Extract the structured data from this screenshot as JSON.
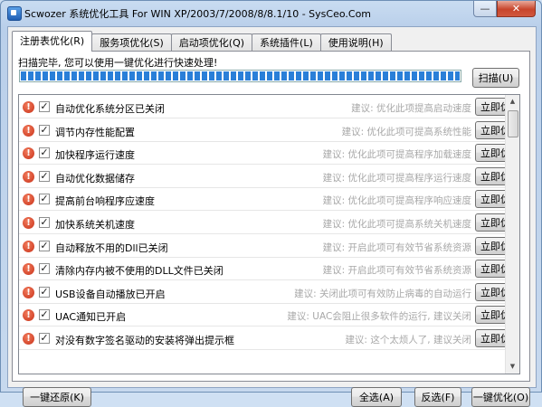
{
  "window": {
    "title": "Scwozer 系统优化工具 For WIN XP/2003/7/2008/8/8.1/10 - SysCeo.Com",
    "minimize_label": "—",
    "close_label": "✕"
  },
  "tabs": [
    {
      "label": "注册表优化(R)",
      "active": true
    },
    {
      "label": "服务项优化(S)",
      "active": false
    },
    {
      "label": "启动项优化(Q)",
      "active": false
    },
    {
      "label": "系统插件(L)",
      "active": false
    },
    {
      "label": "使用说明(H)",
      "active": false
    }
  ],
  "status_text": "扫描完毕, 您可以使用一键优化进行快速处理!",
  "progress": 1.0,
  "scan_button": "扫描(U)",
  "items": [
    {
      "label": "自动优化系统分区已关闭",
      "advice": "建议: 优化此项提高启动速度",
      "checked": true
    },
    {
      "label": "调节内存性能配置",
      "advice": "建议: 优化此项可提高系统性能",
      "checked": true
    },
    {
      "label": "加快程序运行速度",
      "advice": "建议: 优化此项可提高程序加载速度",
      "checked": true
    },
    {
      "label": "自动优化数据储存",
      "advice": "建议: 优化此项可提高程序运行速度",
      "checked": true
    },
    {
      "label": "提高前台响程序应速度",
      "advice": "建议: 优化此项可提高程序响应速度",
      "checked": true
    },
    {
      "label": "加快系统关机速度",
      "advice": "建议: 优化此项可提高系统关机速度",
      "checked": true
    },
    {
      "label": "自动释放不用的Dll已关闭",
      "advice": "建议: 开启此项可有效节省系统资源",
      "checked": true
    },
    {
      "label": "清除内存内被不使用的DLL文件已关闭",
      "advice": "建议: 开启此项可有效节省系统资源",
      "checked": true
    },
    {
      "label": "USB设备自动播放已开启",
      "advice": "建议: 关闭此项可有效防止病毒的自动运行",
      "checked": true
    },
    {
      "label": "UAC通知已开启",
      "advice": "建议: UAC会阻止很多软件的运行, 建议关闭",
      "checked": true
    },
    {
      "label": "对没有数字签名驱动的安装将弹出提示框",
      "advice": "建议: 这个太烦人了, 建议关闭",
      "checked": true
    }
  ],
  "item_button_label": "立即优化",
  "warn_glyph": "!",
  "check_glyph": "✓",
  "footer": {
    "restore": "一键还原(K)",
    "select_all": "全选(A)",
    "invert": "反选(F)",
    "optimize_all": "一键优化(O)"
  },
  "colors": {
    "accent": "#2a7fd8",
    "warning": "#d23a1f",
    "advice_text": "#a8a8a8"
  },
  "icons": {
    "warning": "warning-icon",
    "app": "app-icon"
  }
}
